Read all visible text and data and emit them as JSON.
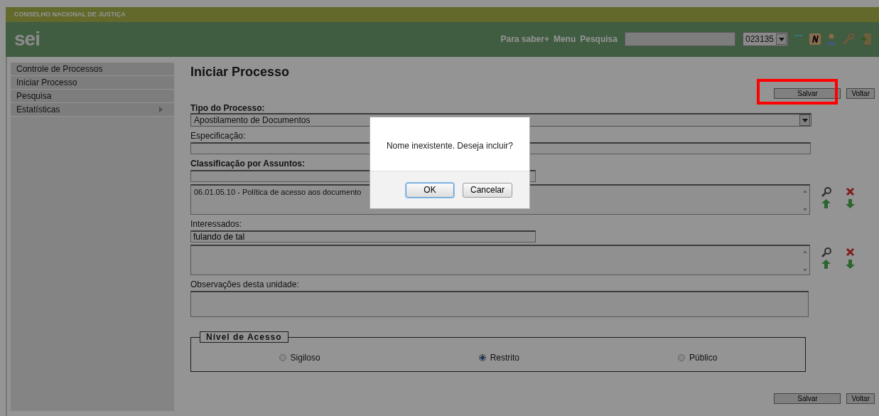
{
  "header": {
    "organization": "CONSELHO NACIONAL DE JUSTIÇA",
    "logo": "sei",
    "links": [
      "Para saber+",
      "Menu",
      "Pesquisa"
    ],
    "unit": {
      "value": "023135"
    }
  },
  "sidebar": {
    "items": [
      {
        "label": "Controle de Processos",
        "has_submenu": false
      },
      {
        "label": "Iniciar Processo",
        "has_submenu": false
      },
      {
        "label": "Pesquisa",
        "has_submenu": false
      },
      {
        "label": "Estatísticas",
        "has_submenu": true
      }
    ]
  },
  "page": {
    "title": "Iniciar Processo",
    "top_buttons": [
      "Salvar",
      "Voltar"
    ],
    "tipo": {
      "label": "Tipo do Processo:",
      "value": "Apostilamento de Documentos"
    },
    "especificacao": {
      "label": "Especificação:"
    },
    "classificacao": {
      "label": "Classificação por Assuntos:",
      "list": [
        "06.01.05.10 - Política de acesso aos documento"
      ]
    },
    "interessados": {
      "label": "Interessados:",
      "value": "fulando de tal"
    },
    "observacoes": {
      "label": "Observações desta unidade:"
    },
    "nivel": {
      "legend": "Nível de Acesso",
      "options": [
        {
          "label": "Sigiloso",
          "selected": false
        },
        {
          "label": "Restrito",
          "selected": true
        },
        {
          "label": "Público",
          "selected": false
        }
      ]
    },
    "bottom_buttons": [
      "Salvar",
      "Voltar"
    ]
  },
  "dialog": {
    "message": "Nome inexistente. Deseja incluir?",
    "buttons": [
      {
        "label": "OK",
        "kind": "default"
      },
      {
        "label": "Cancelar",
        "kind": "normal"
      }
    ]
  }
}
